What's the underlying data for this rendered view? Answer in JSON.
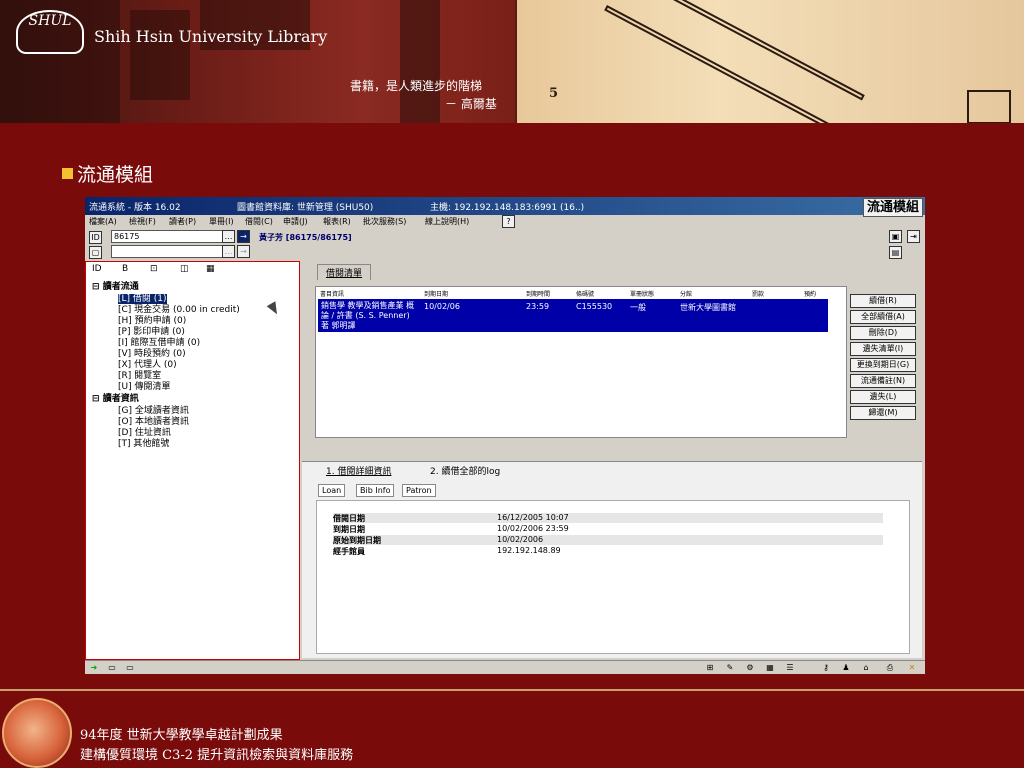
{
  "header": {
    "library_name": "Shih Hsin University Library",
    "logo_text": "SHUL",
    "motto": "書籍，是人類進步的階梯",
    "motto_author": "－ 高爾基",
    "stair_number": "5"
  },
  "slide": {
    "section_title": "流通模組"
  },
  "app": {
    "title": "流通系統 - 版本 16.02",
    "db_label": "圖書館資料庫: 世新管理 (SHU50)",
    "host": "主機: 192.192.148.183:6991 (16..)",
    "module_badge": "流通模組",
    "menu": [
      "檔案(A)",
      "檢視(F)",
      "讀者(P)",
      "單冊(I)",
      "借閱(C)",
      "申請(J)",
      "報表(R)",
      "批次服務(S)",
      "線上說明(H)"
    ],
    "help_button": "?",
    "patron_input": "86175",
    "go_symbol": "→",
    "patron_label": "黃子芳 [86175/86175]",
    "left_tabs": [
      "ID",
      "B",
      "⊡",
      "◫",
      "▦"
    ],
    "tree": {
      "group1_title": "讀者流通",
      "group1_items": [
        "[L] 借閱 (1)",
        "[C] 現金交易 (0.00 in credit)",
        "[H] 預約申請 (0)",
        "[P] 影印申請 (0)",
        "[I] 館際互借申請 (0)",
        "[V] 時段預約 (0)",
        "[X] 代理人 (0)",
        "[R] 閱覽室",
        "[U] 傳閱清單"
      ],
      "group2_title": "讀者資訊",
      "group2_items": [
        "[G] 全域讀者資訊",
        "[O] 本地讀者資訊",
        "[D] 住址資訊",
        "[T] 其他館號"
      ]
    },
    "borrow_tab": "借閱清單",
    "columns": [
      "書目資訊",
      "到期日期",
      "到期時間",
      "條碼號",
      "單冊狀態",
      "分館",
      "罰款",
      "預約"
    ],
    "row": {
      "title": "銷售學 教學及銷售產業 概論 / 許書 (S. S. Penner)著 郭明譯",
      "due_date": "10/02/06",
      "due_time": "23:59",
      "barcode": "C155530",
      "status": "一般",
      "branch": "世新大學圖書館",
      "fine": "",
      "hold": ""
    },
    "side_buttons": [
      "續借(R)",
      "全部續借(A)",
      "刪除(D)",
      "遺失清單(I)",
      "更換到期日(G)",
      "流通備註(N)",
      "遺失(L)",
      "歸還(M)"
    ],
    "detail_tabs": [
      "1. 借閱詳細資訊",
      "2. 續借全部的log"
    ],
    "sub_tabs": [
      "Loan",
      "Bib Info",
      "Patron"
    ],
    "details": [
      {
        "label": "借閱日期",
        "value": "16/12/2005 10:07"
      },
      {
        "label": "到期日期",
        "value": "10/02/2006 23:59"
      },
      {
        "label": "原始到期日期",
        "value": "10/02/2006"
      },
      {
        "label": "經手館員",
        "value": "192.192.148.89"
      }
    ]
  },
  "footer": {
    "line1": "94年度 世新大學教學卓越計劃成果",
    "line2": "建構優質環境 C3-2 提升資訊檢索與資料庫服務"
  },
  "colors": {
    "background": "#7a0b0b",
    "bullet": "#f2c230",
    "selection": "#0000a8",
    "titlebar": "#0a246a"
  }
}
